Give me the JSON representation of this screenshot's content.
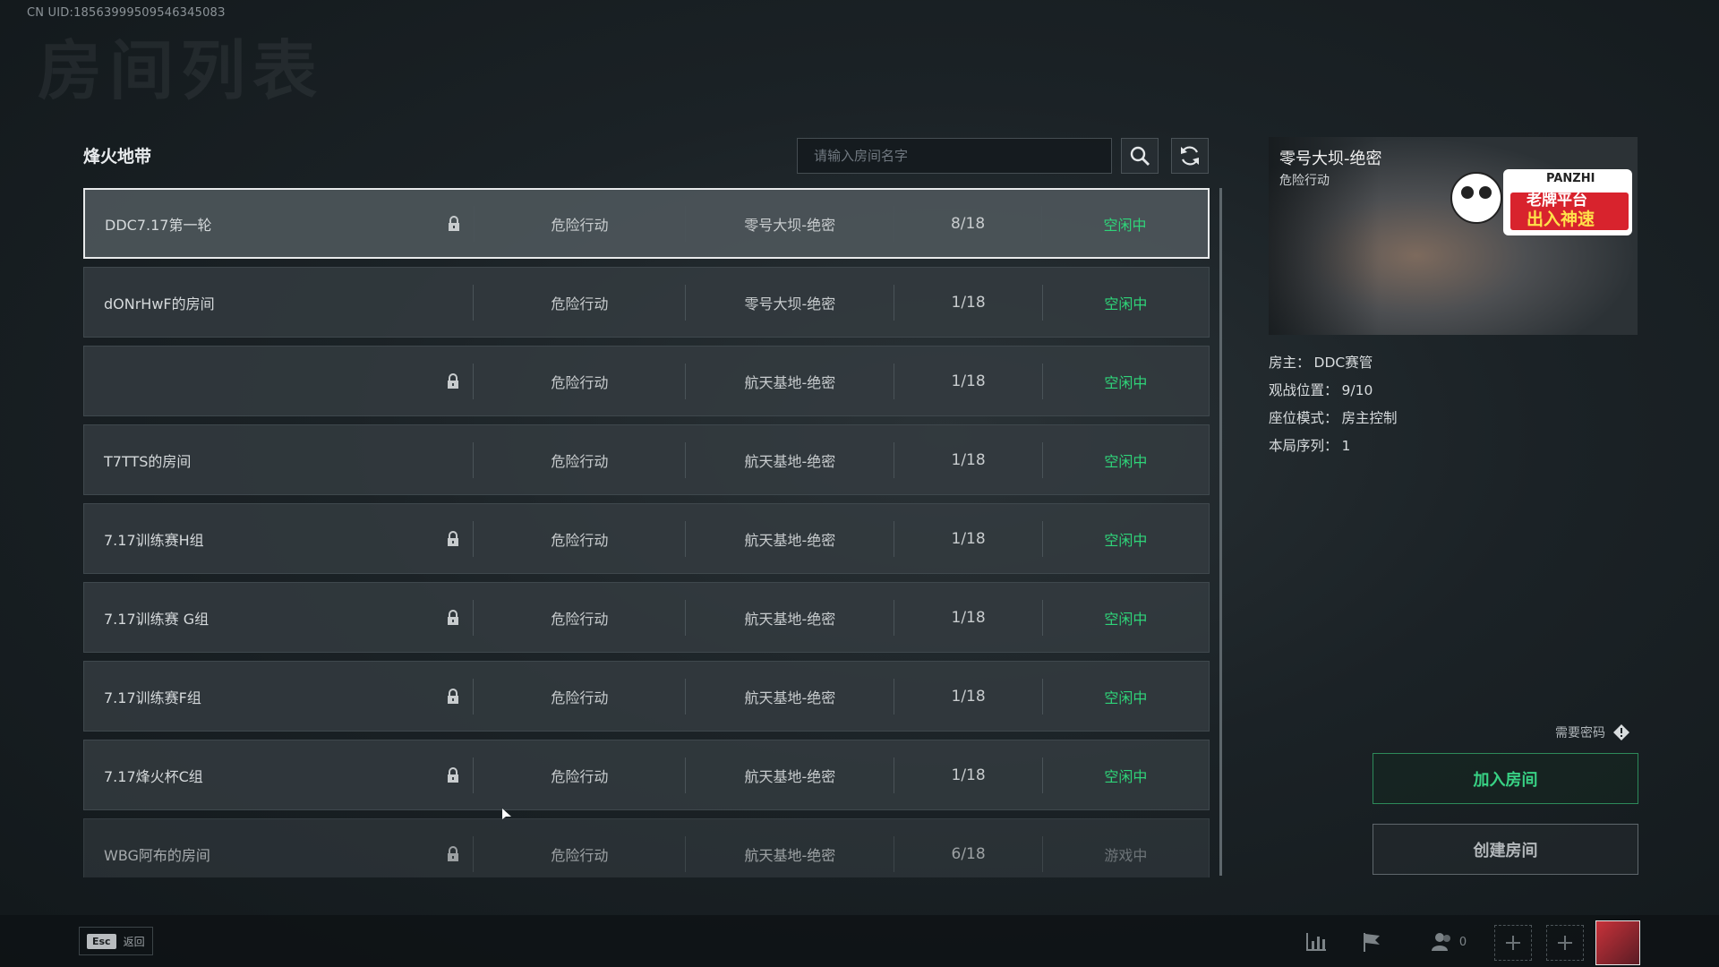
{
  "uid": "CN UID:1856399950954634508З",
  "page_title": "房间列表",
  "mode_title": "烽火地带",
  "search": {
    "placeholder": "请输入房间名字"
  },
  "rooms": [
    {
      "name": "DDC7.17第一轮",
      "locked": true,
      "mode": "危险行动",
      "map": "零号大坝-绝密",
      "count": "8/18",
      "status": "空闲中",
      "selected": true
    },
    {
      "name": "dONrHwF的房间",
      "locked": false,
      "mode": "危险行动",
      "map": "零号大坝-绝密",
      "count": "1/18",
      "status": "空闲中"
    },
    {
      "name": "",
      "locked": true,
      "mode": "危险行动",
      "map": "航天基地-绝密",
      "count": "1/18",
      "status": "空闲中"
    },
    {
      "name": "T7TTS的房间",
      "locked": false,
      "mode": "危险行动",
      "map": "航天基地-绝密",
      "count": "1/18",
      "status": "空闲中"
    },
    {
      "name": "7.17训练赛H组",
      "locked": true,
      "mode": "危险行动",
      "map": "航天基地-绝密",
      "count": "1/18",
      "status": "空闲中"
    },
    {
      "name": "7.17训练赛 G组",
      "locked": true,
      "mode": "危险行动",
      "map": "航天基地-绝密",
      "count": "1/18",
      "status": "空闲中"
    },
    {
      "name": "7.17训练赛F组",
      "locked": true,
      "mode": "危险行动",
      "map": "航天基地-绝密",
      "count": "1/18",
      "status": "空闲中"
    },
    {
      "name": "7.17烽火杯C组",
      "locked": true,
      "mode": "危险行动",
      "map": "航天基地-绝密",
      "count": "1/18",
      "status": "空闲中"
    },
    {
      "name": "WBG阿布的房间",
      "locked": true,
      "mode": "危险行动",
      "map": "航天基地-绝密",
      "count": "6/18",
      "status": "游戏中"
    }
  ],
  "preview": {
    "map": "零号大坝-绝密",
    "mode": "危险行动",
    "badge_brand": "PANZHI",
    "badge_line1": "老牌平台",
    "badge_line2": "出入神速"
  },
  "details": {
    "owner_label": "房主：",
    "owner": "DDC赛管",
    "spectate_label": "观战位置：",
    "spectate": "9/10",
    "seat_label": "座位模式：",
    "seat": "房主控制",
    "round_label": "本局序列：",
    "round": "1"
  },
  "need_password": "需要密码",
  "join_button": "加入房间",
  "create_button": "创建房间",
  "bottom": {
    "esc_key": "Esc",
    "esc_label": "返回",
    "friends_count": "0"
  },
  "colors": {
    "status_idle": "#2fd479",
    "status_playing": "#8a9195",
    "accent": "#38d184"
  },
  "icons": [
    "search-icon",
    "refresh-icon",
    "lock-icon",
    "info-diamond-icon",
    "stats-icon",
    "flag-icon",
    "friends-icon",
    "plus-icon"
  ]
}
